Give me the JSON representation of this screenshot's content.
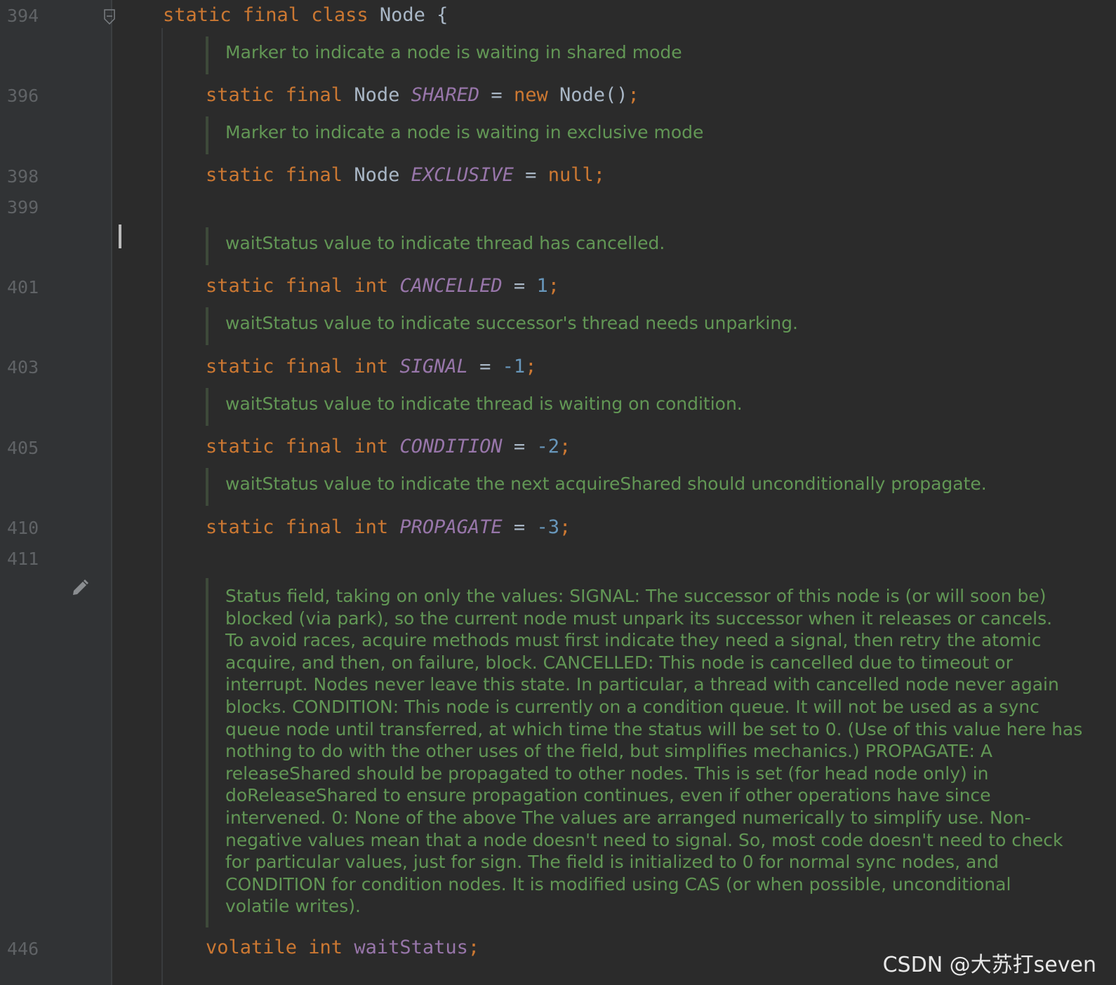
{
  "line_numbers": [
    "394",
    "396",
    "398",
    "399",
    "401",
    "403",
    "405",
    "410",
    "411",
    "446"
  ],
  "code": {
    "l394": {
      "kw": "static final class ",
      "name": "Node",
      "rest": " {"
    },
    "l396": {
      "kw": "static final ",
      "type": "Node ",
      "field": "SHARED",
      "eq": " = ",
      "kw2": "new ",
      "val": "Node()",
      "semi": ";"
    },
    "l398": {
      "kw": "static final ",
      "type": "Node ",
      "field": "EXCLUSIVE",
      "eq": " = ",
      "val": "null",
      "semi": ";"
    },
    "l401": {
      "kw": "static final int ",
      "field": "CANCELLED",
      "eq": " = ",
      "val": "1",
      "semi": ";"
    },
    "l403": {
      "kw": "static final int ",
      "field": "SIGNAL",
      "eq": " = ",
      "val": "-1",
      "semi": ";"
    },
    "l405": {
      "kw": "static final int ",
      "field": "CONDITION",
      "eq": " = ",
      "val": "-2",
      "semi": ";"
    },
    "l410": {
      "kw": "static final int ",
      "field": "PROPAGATE",
      "eq": " = ",
      "val": "-3",
      "semi": ";"
    },
    "l446": {
      "kw": "volatile int ",
      "field": "waitStatus",
      "semi": ";"
    }
  },
  "docs": {
    "shared": "Marker to indicate a node is waiting in shared mode",
    "exclusive": "Marker to indicate a node is waiting in exclusive mode",
    "cancelled": "waitStatus value to indicate thread has cancelled.",
    "signal": "waitStatus value to indicate successor's thread needs unparking.",
    "condition": "waitStatus value to indicate thread is waiting on condition.",
    "propagate": "waitStatus value to indicate the next acquireShared should unconditionally propagate.",
    "status": [
      "Status field, taking on only the values: SIGNAL: The successor of this node is (or will soon be)",
      "blocked (via park), so the current node must unpark its successor when it releases or cancels.",
      "To avoid races, acquire methods must first indicate they need a signal, then retry the atomic",
      "acquire, and then, on failure, block. CANCELLED: This node is cancelled due to timeout or",
      "interrupt. Nodes never leave this state. In particular, a thread with cancelled node never again",
      "blocks. CONDITION: This node is currently on a condition queue. It will not be used as a sync",
      "queue node until transferred, at which time the status will be set to 0. (Use of this value here has",
      "nothing to do with the other uses of the field, but simplifies mechanics.) PROPAGATE: A",
      "releaseShared should be propagated to other nodes. This is set (for head node only) in",
      "doReleaseShared to ensure propagation continues, even if other operations have since",
      "intervened. 0: None of the above The values are arranged numerically to simplify use. Non-",
      "negative values mean that a node doesn't need to signal. So, most code doesn't need to check",
      "for particular values, just for sign. The field is initialized to 0 for normal sync nodes, and",
      "CONDITION for condition nodes. It is modified using CAS (or when possible, unconditional",
      "volatile writes)."
    ]
  },
  "watermark": "CSDN @大苏打seven",
  "colors": {
    "background": "#2b2b2b",
    "gutter": "#313335",
    "keyword": "#cc7832",
    "field": "#9876aa",
    "number": "#6897bb",
    "doc_comment": "#629755",
    "line_number": "#606366"
  },
  "icons": [
    "fold-icon",
    "pencil-icon"
  ]
}
